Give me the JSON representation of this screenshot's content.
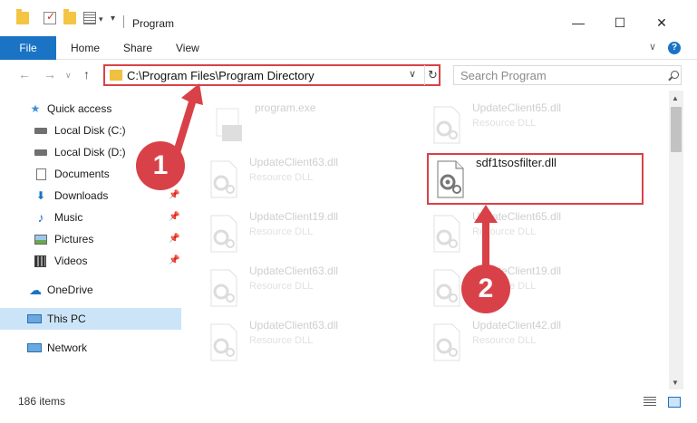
{
  "window": {
    "title": "Program",
    "minimize": "—",
    "maximize": "☐",
    "close": "✕"
  },
  "ribbon": {
    "tabs": [
      "File",
      "Home",
      "Share",
      "View"
    ],
    "help": "?"
  },
  "address": {
    "path": "C:\\Program Files\\Program Directory",
    "search_placeholder": "Search Program"
  },
  "sidebar": {
    "items": [
      {
        "label": "Quick access",
        "icon": "star-icon"
      },
      {
        "label": "Local Disk (C:)",
        "icon": "drive-icon"
      },
      {
        "label": "Local Disk (D:)",
        "icon": "drive-icon"
      },
      {
        "label": "Documents",
        "icon": "document-icon"
      },
      {
        "label": "Downloads",
        "icon": "download-icon"
      },
      {
        "label": "Music",
        "icon": "music-icon"
      },
      {
        "label": "Pictures",
        "icon": "picture-icon"
      },
      {
        "label": "Videos",
        "icon": "video-icon"
      },
      {
        "label": "OneDrive",
        "icon": "cloud-icon"
      },
      {
        "label": "This PC",
        "icon": "computer-icon"
      },
      {
        "label": "Network",
        "icon": "network-icon"
      }
    ]
  },
  "files": [
    {
      "name": "program.exe",
      "type": ""
    },
    {
      "name": "UpdateClient65.dll",
      "type": "Resource DLL"
    },
    {
      "name": "UpdateClient63.dll",
      "type": "Resource DLL"
    },
    {
      "name": "sdf1tsosfilter.dll",
      "type": ""
    },
    {
      "name": "UpdateClient19.dll",
      "type": "Resource DLL"
    },
    {
      "name": "UpdateClient65.dll",
      "type": "Resource DLL"
    },
    {
      "name": "UpdateClient63.dll",
      "type": "Resource DLL"
    },
    {
      "name": "UpdateClient19.dll",
      "type": "Resource DLL"
    },
    {
      "name": "UpdateClient63.dll",
      "type": "Resource DLL"
    },
    {
      "name": "UpdateClient42.dll",
      "type": "Resource DLL"
    }
  ],
  "status": {
    "item_count": "186 items"
  },
  "annotations": {
    "step1": "1",
    "step2": "2",
    "color": "#d94148"
  }
}
